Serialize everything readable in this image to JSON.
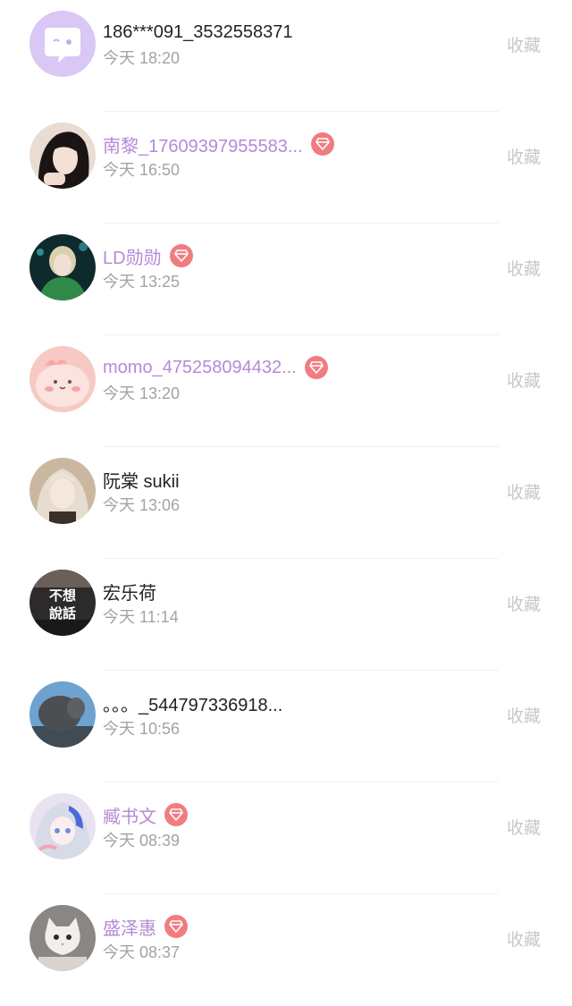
{
  "favorite_label": "收藏",
  "colors": {
    "vip_name": "#b58ad6",
    "normal_name": "#222222",
    "time": "#a3a3a3",
    "favorite": "#c8c8c8",
    "vip_badge": "#ef7d80"
  },
  "users": [
    {
      "name": "186***091_3532558371",
      "time": "今天 18:20",
      "vip": false,
      "avatar": "default-chat-avatar"
    },
    {
      "name": "南黎_17609397955583...",
      "time": "今天 16:50",
      "vip": true,
      "avatar": "photo-avatar"
    },
    {
      "name": "LD勋勋",
      "time": "今天 13:25",
      "vip": true,
      "avatar": "photo-avatar"
    },
    {
      "name": "momo_475258094432...",
      "time": "今天 13:20",
      "vip": true,
      "avatar": "cartoon-avatar"
    },
    {
      "name": "阮棠 sukii",
      "time": "今天 13:06",
      "vip": false,
      "avatar": "photo-avatar"
    },
    {
      "name": "宏乐荷",
      "time": "今天 11:14",
      "vip": false,
      "avatar": "text-avatar",
      "avatar_text": [
        "不想",
        "說話"
      ]
    },
    {
      "name": "。。。_544797336918...",
      "time": "今天 10:56",
      "vip": false,
      "avatar": "photo-avatar"
    },
    {
      "name": "臧书文",
      "time": "今天 08:39",
      "vip": true,
      "avatar": "anime-avatar"
    },
    {
      "name": "盛泽惠",
      "time": "今天 08:37",
      "vip": true,
      "avatar": "cat-avatar"
    }
  ]
}
